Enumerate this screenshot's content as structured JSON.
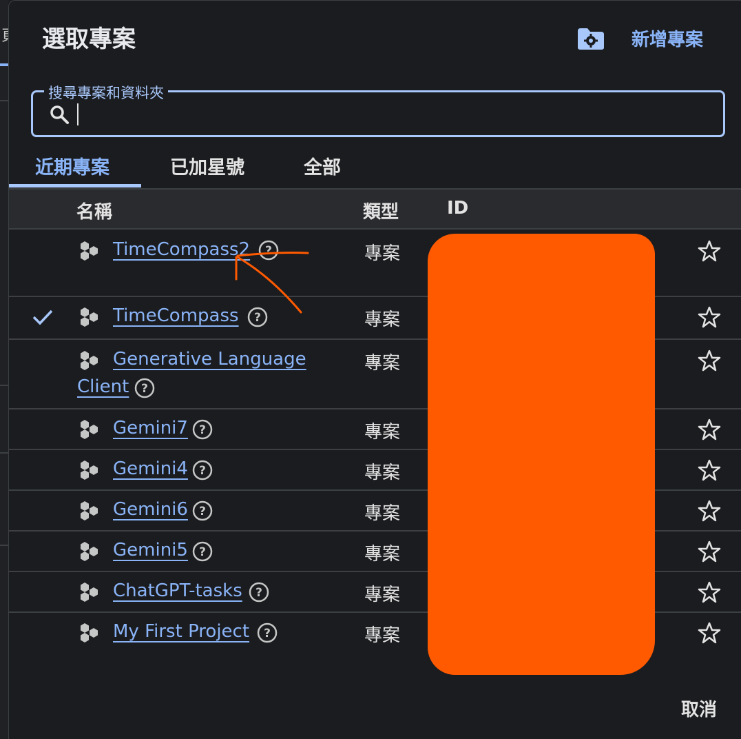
{
  "dialog": {
    "title": "選取專案",
    "new_project_label": "新增專案",
    "search": {
      "legend": "搜尋專案和資料夾",
      "value": ""
    },
    "tabs": [
      {
        "label": "近期專案",
        "active": true
      },
      {
        "label": "已加星號",
        "active": false
      },
      {
        "label": "全部",
        "active": false
      }
    ],
    "columns": {
      "name": "名稱",
      "type": "類型",
      "id": "ID"
    },
    "rows": [
      {
        "name": "TimeCompass2",
        "type": "專案",
        "selected": false,
        "starred": false
      },
      {
        "name": "TimeCompass",
        "type": "專案",
        "selected": true,
        "starred": false
      },
      {
        "name_line1": "Generative Language",
        "name_line2": "Client",
        "type": "專案",
        "selected": false,
        "starred": false
      },
      {
        "name": "Gemini7",
        "type": "專案",
        "selected": false,
        "starred": false
      },
      {
        "name": "Gemini4",
        "type": "專案",
        "selected": false,
        "starred": false
      },
      {
        "name": "Gemini6",
        "type": "專案",
        "selected": false,
        "starred": false
      },
      {
        "name": "Gemini5",
        "type": "專案",
        "selected": false,
        "starred": false
      },
      {
        "name": "ChatGPT-tasks",
        "type": "專案",
        "selected": false,
        "starred": false
      },
      {
        "name": "My First Project",
        "type": "專案",
        "selected": false,
        "starred": false
      }
    ],
    "cancel_label": "取消"
  },
  "colors": {
    "accent": "#8ab4f8",
    "background": "#1b1c1f",
    "redaction": "#ff5a00",
    "annotation": "#ff5a00"
  },
  "icons": [
    "settings-folder-icon",
    "search-icon",
    "project-icon",
    "help-icon",
    "check-icon",
    "star-outline-icon"
  ]
}
